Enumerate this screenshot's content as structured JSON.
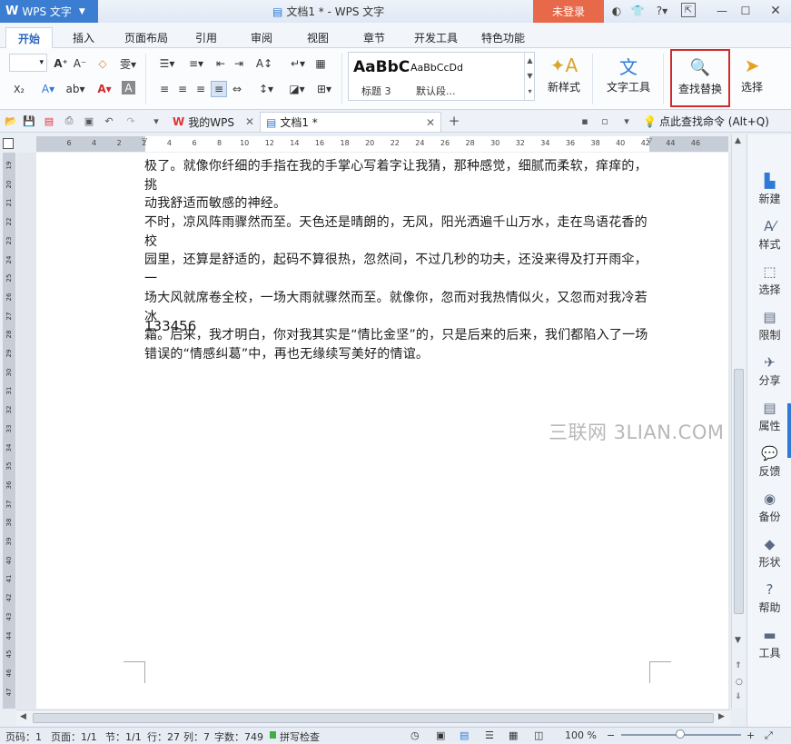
{
  "titlebar": {
    "app_menu": "WPS 文字",
    "doc_title": "文档1 * - WPS 文字",
    "login": "未登录",
    "help": "?",
    "controls": [
      "minimize",
      "maximize",
      "close"
    ]
  },
  "menu_tabs": [
    "开始",
    "插入",
    "页面布局",
    "引用",
    "审阅",
    "视图",
    "章节",
    "开发工具",
    "特色功能"
  ],
  "ribbon": {
    "styles": {
      "preview1": "AaBbC",
      "preview2": "AaBbCcDd",
      "label1": "标题 3",
      "label2": "默认段..."
    },
    "new_style": "新样式",
    "text_tools": "文字工具",
    "find_replace": "查找替换",
    "select": "选择"
  },
  "quickbar": {
    "tab_my_wps": "我的WPS",
    "tab_doc1": "文档1 *",
    "find_command": "点此查找命令 (Alt+Q)"
  },
  "ruler": {
    "h_ticks": [
      "6",
      "4",
      "2",
      "2",
      "4",
      "6",
      "8",
      "10",
      "12",
      "14",
      "16",
      "18",
      "20",
      "22",
      "24",
      "26",
      "28",
      "30",
      "32",
      "34",
      "36",
      "38",
      "40",
      "42",
      "44",
      "46"
    ],
    "v_ticks": [
      "19",
      "20",
      "21",
      "22",
      "23",
      "24",
      "25",
      "26",
      "27",
      "28",
      "29",
      "30",
      "31",
      "32",
      "33",
      "34",
      "35",
      "36",
      "37",
      "38",
      "39",
      "40",
      "41",
      "42",
      "43",
      "44",
      "45",
      "46",
      "47"
    ]
  },
  "document": {
    "para1_lines": [
      "极了。就像你纤细的手指在我的手掌心写着字让我猜，那种感觉，细腻而柔软，痒痒的，挑",
      "动我舒适而敏感的神经。"
    ],
    "para2_lines": [
      "不时，凉风阵雨骤然而至。天色还是晴朗的，无风，阳光洒遍千山万水，走在鸟语花香的校",
      "园里，还算是舒适的，起码不算很热，忽然间，不过几秒的功夫，还没来得及打开雨伞，一",
      "场大风就席卷全校，一场大雨就骤然而至。就像你，忽而对我热情似火，又忽而对我冷若冰",
      "霜。后来，我才明白，你对我其实是“情比金坚”的，只是后来的后来，我们都陷入了一场",
      "错误的“情感纠葛”中，再也无缘续写美好的情谊。"
    ],
    "number_line": "133456",
    "watermark": "三联网 3LIAN.COM"
  },
  "sidepanel": [
    "新建",
    "样式",
    "选择",
    "限制",
    "分享",
    "属性",
    "反馈",
    "备份",
    "形状",
    "帮助",
    "工具"
  ],
  "status": {
    "page_num": "页码：1",
    "pages": "页面：1/1",
    "section": "节：1/1",
    "row": "行：27",
    "col": "列：7",
    "words": "字数：749",
    "spell": "拼写检查",
    "zoom": "100 %"
  },
  "colors": {
    "accent": "#2e7ad6",
    "app_menu": "#3a7dd1",
    "login": "#e8694a",
    "highlight_box": "#d32a2a"
  }
}
